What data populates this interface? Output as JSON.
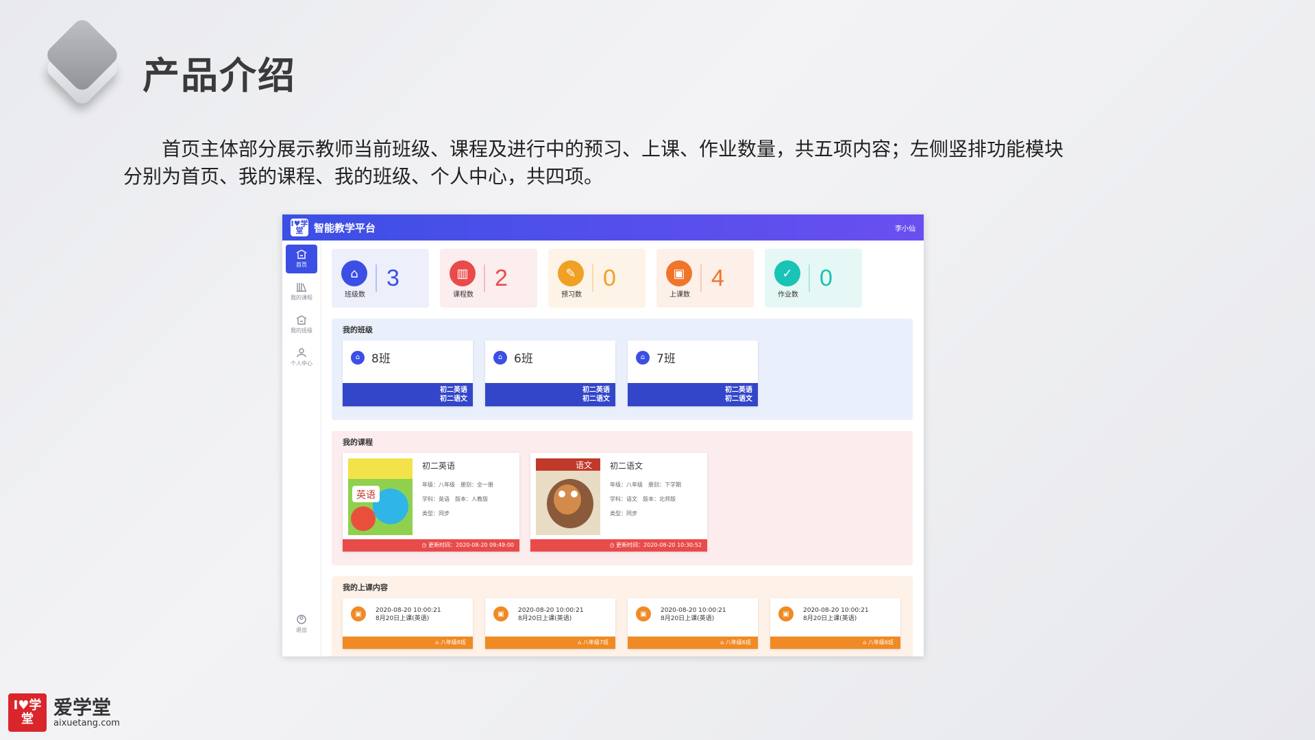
{
  "slide": {
    "title": "产品介绍",
    "description": "首页主体部分展示教师当前班级、课程及进行中的预习、上课、作业数量，共五项内容；左侧竖排功能模块分别为首页、我的课程、我的班级、个人中心，共四项。"
  },
  "app": {
    "logo_text": "I♥学堂",
    "title": "智能教学平台",
    "user": "李小仙",
    "colors": {
      "primary": "#3b4fe4",
      "red": "#e94b4b",
      "orange": "#f08a24",
      "teal": "#19c3b5"
    }
  },
  "sidebar": {
    "items": [
      {
        "label": "首页",
        "icon": "home-icon",
        "active": true
      },
      {
        "label": "我的课程",
        "icon": "books-icon",
        "active": false
      },
      {
        "label": "我的班级",
        "icon": "class-icon",
        "active": false
      },
      {
        "label": "个人中心",
        "icon": "user-icon",
        "active": false
      }
    ],
    "logout_label": "退出"
  },
  "stats": [
    {
      "label": "班级数",
      "value": "3",
      "color": "#3b4fe4",
      "bg": "#edf0fb",
      "icon": "class-icon"
    },
    {
      "label": "课程数",
      "value": "2",
      "color": "#e94b4b",
      "bg": "#fcedee",
      "icon": "books-icon"
    },
    {
      "label": "预习数",
      "value": "0",
      "color": "#f0a024",
      "bg": "#fdf3e7",
      "icon": "preview-icon"
    },
    {
      "label": "上课数",
      "value": "4",
      "color": "#f0742a",
      "bg": "#fdf0e8",
      "icon": "lesson-icon"
    },
    {
      "label": "作业数",
      "value": "0",
      "color": "#19c3b5",
      "bg": "#e6f8f5",
      "icon": "homework-icon"
    }
  ],
  "my_classes": {
    "title": "我的班级",
    "items": [
      {
        "name": "8班",
        "courses": [
          "初二英语",
          "初二语文"
        ]
      },
      {
        "name": "6班",
        "courses": [
          "初二英语",
          "初二语文"
        ]
      },
      {
        "name": "7班",
        "courses": [
          "初二英语",
          "初二语文"
        ]
      }
    ]
  },
  "my_courses": {
    "title": "我的课程",
    "items": [
      {
        "name": "初二英语",
        "meta": [
          "年级：八年级　册别：全一册",
          "学科：英语　版本：人教版",
          "类型：同步"
        ],
        "updated": "更新时间：2020-08-20 09:49:00",
        "cover_text": "英语"
      },
      {
        "name": "初二语文",
        "meta": [
          "年级：八年级　册别：下学期",
          "学科：语文　版本：北师版",
          "类型：同步"
        ],
        "updated": "更新时间：2020-08-20 10:30:52",
        "cover_text": "语文"
      }
    ]
  },
  "my_lessons": {
    "title": "我的上课内容",
    "items": [
      {
        "time": "2020-08-20 10:00:21",
        "desc": "8月20日上课(英语)",
        "class": "八年级8班"
      },
      {
        "time": "2020-08-20 10:00:21",
        "desc": "8月20日上课(英语)",
        "class": "八年级7班"
      },
      {
        "time": "2020-08-20 10:00:21",
        "desc": "8月20日上课(英语)",
        "class": "八年级6班"
      },
      {
        "time": "2020-08-20 10:00:21",
        "desc": "8月20日上课(英语)",
        "class": "八年级6班"
      }
    ]
  },
  "brand": {
    "logo_text": "I♥学堂",
    "name": "爱学堂",
    "domain": "aixuetang.com"
  }
}
